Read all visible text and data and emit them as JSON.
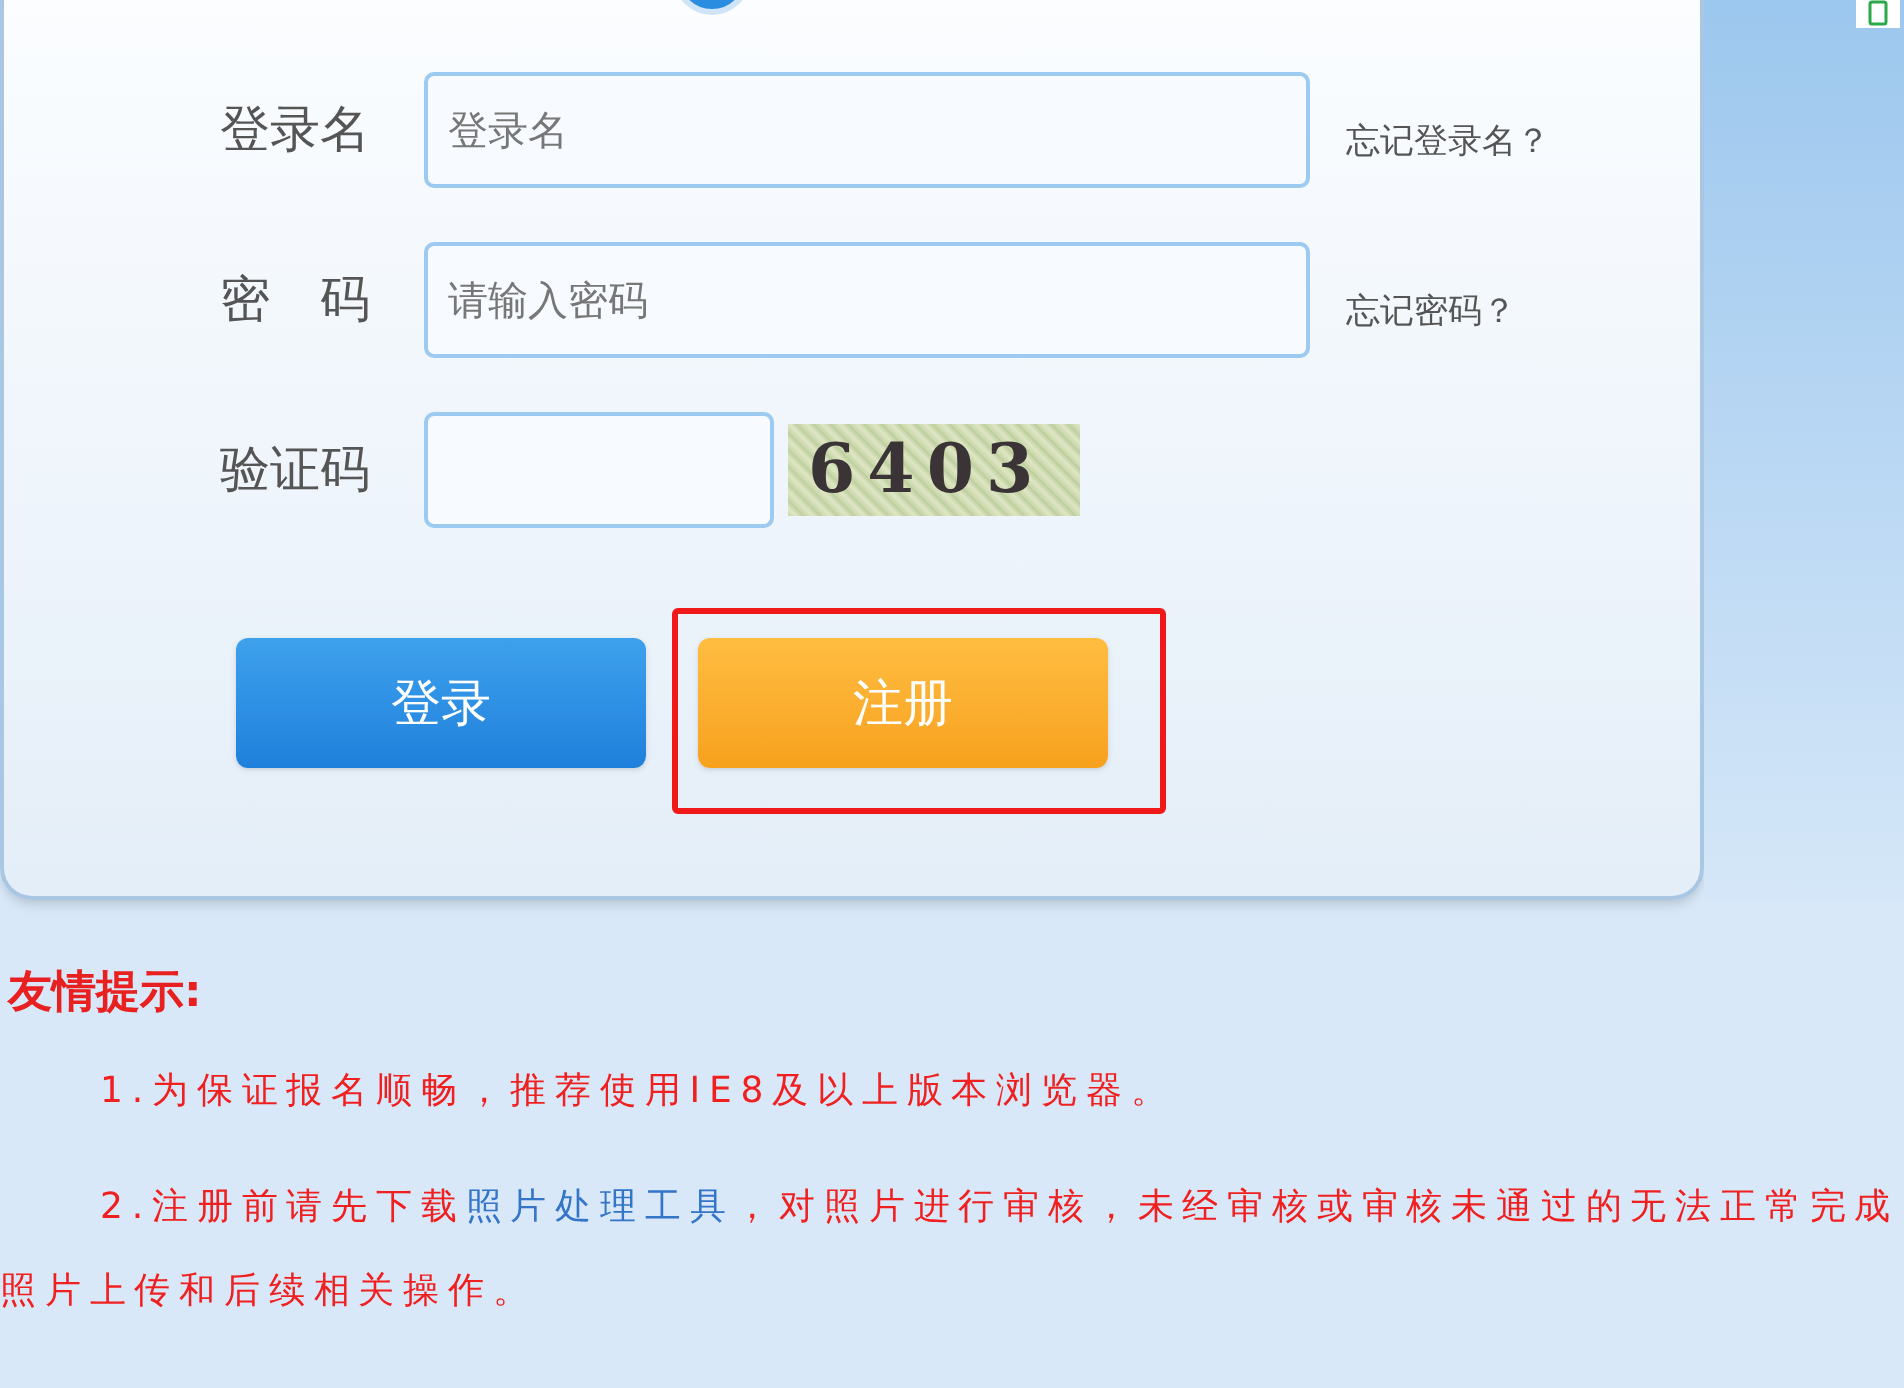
{
  "form": {
    "fields": [
      {
        "label": "登录名",
        "placeholder": "登录名",
        "help_link": "忘记登录名？"
      },
      {
        "label": "密　码",
        "placeholder": "请输入密码",
        "help_link": "忘记密码？"
      }
    ],
    "captcha": {
      "label": "验证码",
      "code": "6403"
    },
    "buttons": [
      {
        "label": "登录",
        "kind": "primary",
        "highlighted": false
      },
      {
        "label": "注册",
        "kind": "secondary",
        "highlighted": true
      }
    ]
  },
  "notice": {
    "title": "友情提示:",
    "items": [
      {
        "before": "1.为保证报名顺畅，推荐使用IE8及以上版本浏览器。"
      },
      {
        "before": "2.注册前请先下载",
        "link": "照片处理工具",
        "after": "，对照片进行审核，未经审核或审核未通过的无法正常完成照片上传和后续相关操作。"
      }
    ]
  }
}
